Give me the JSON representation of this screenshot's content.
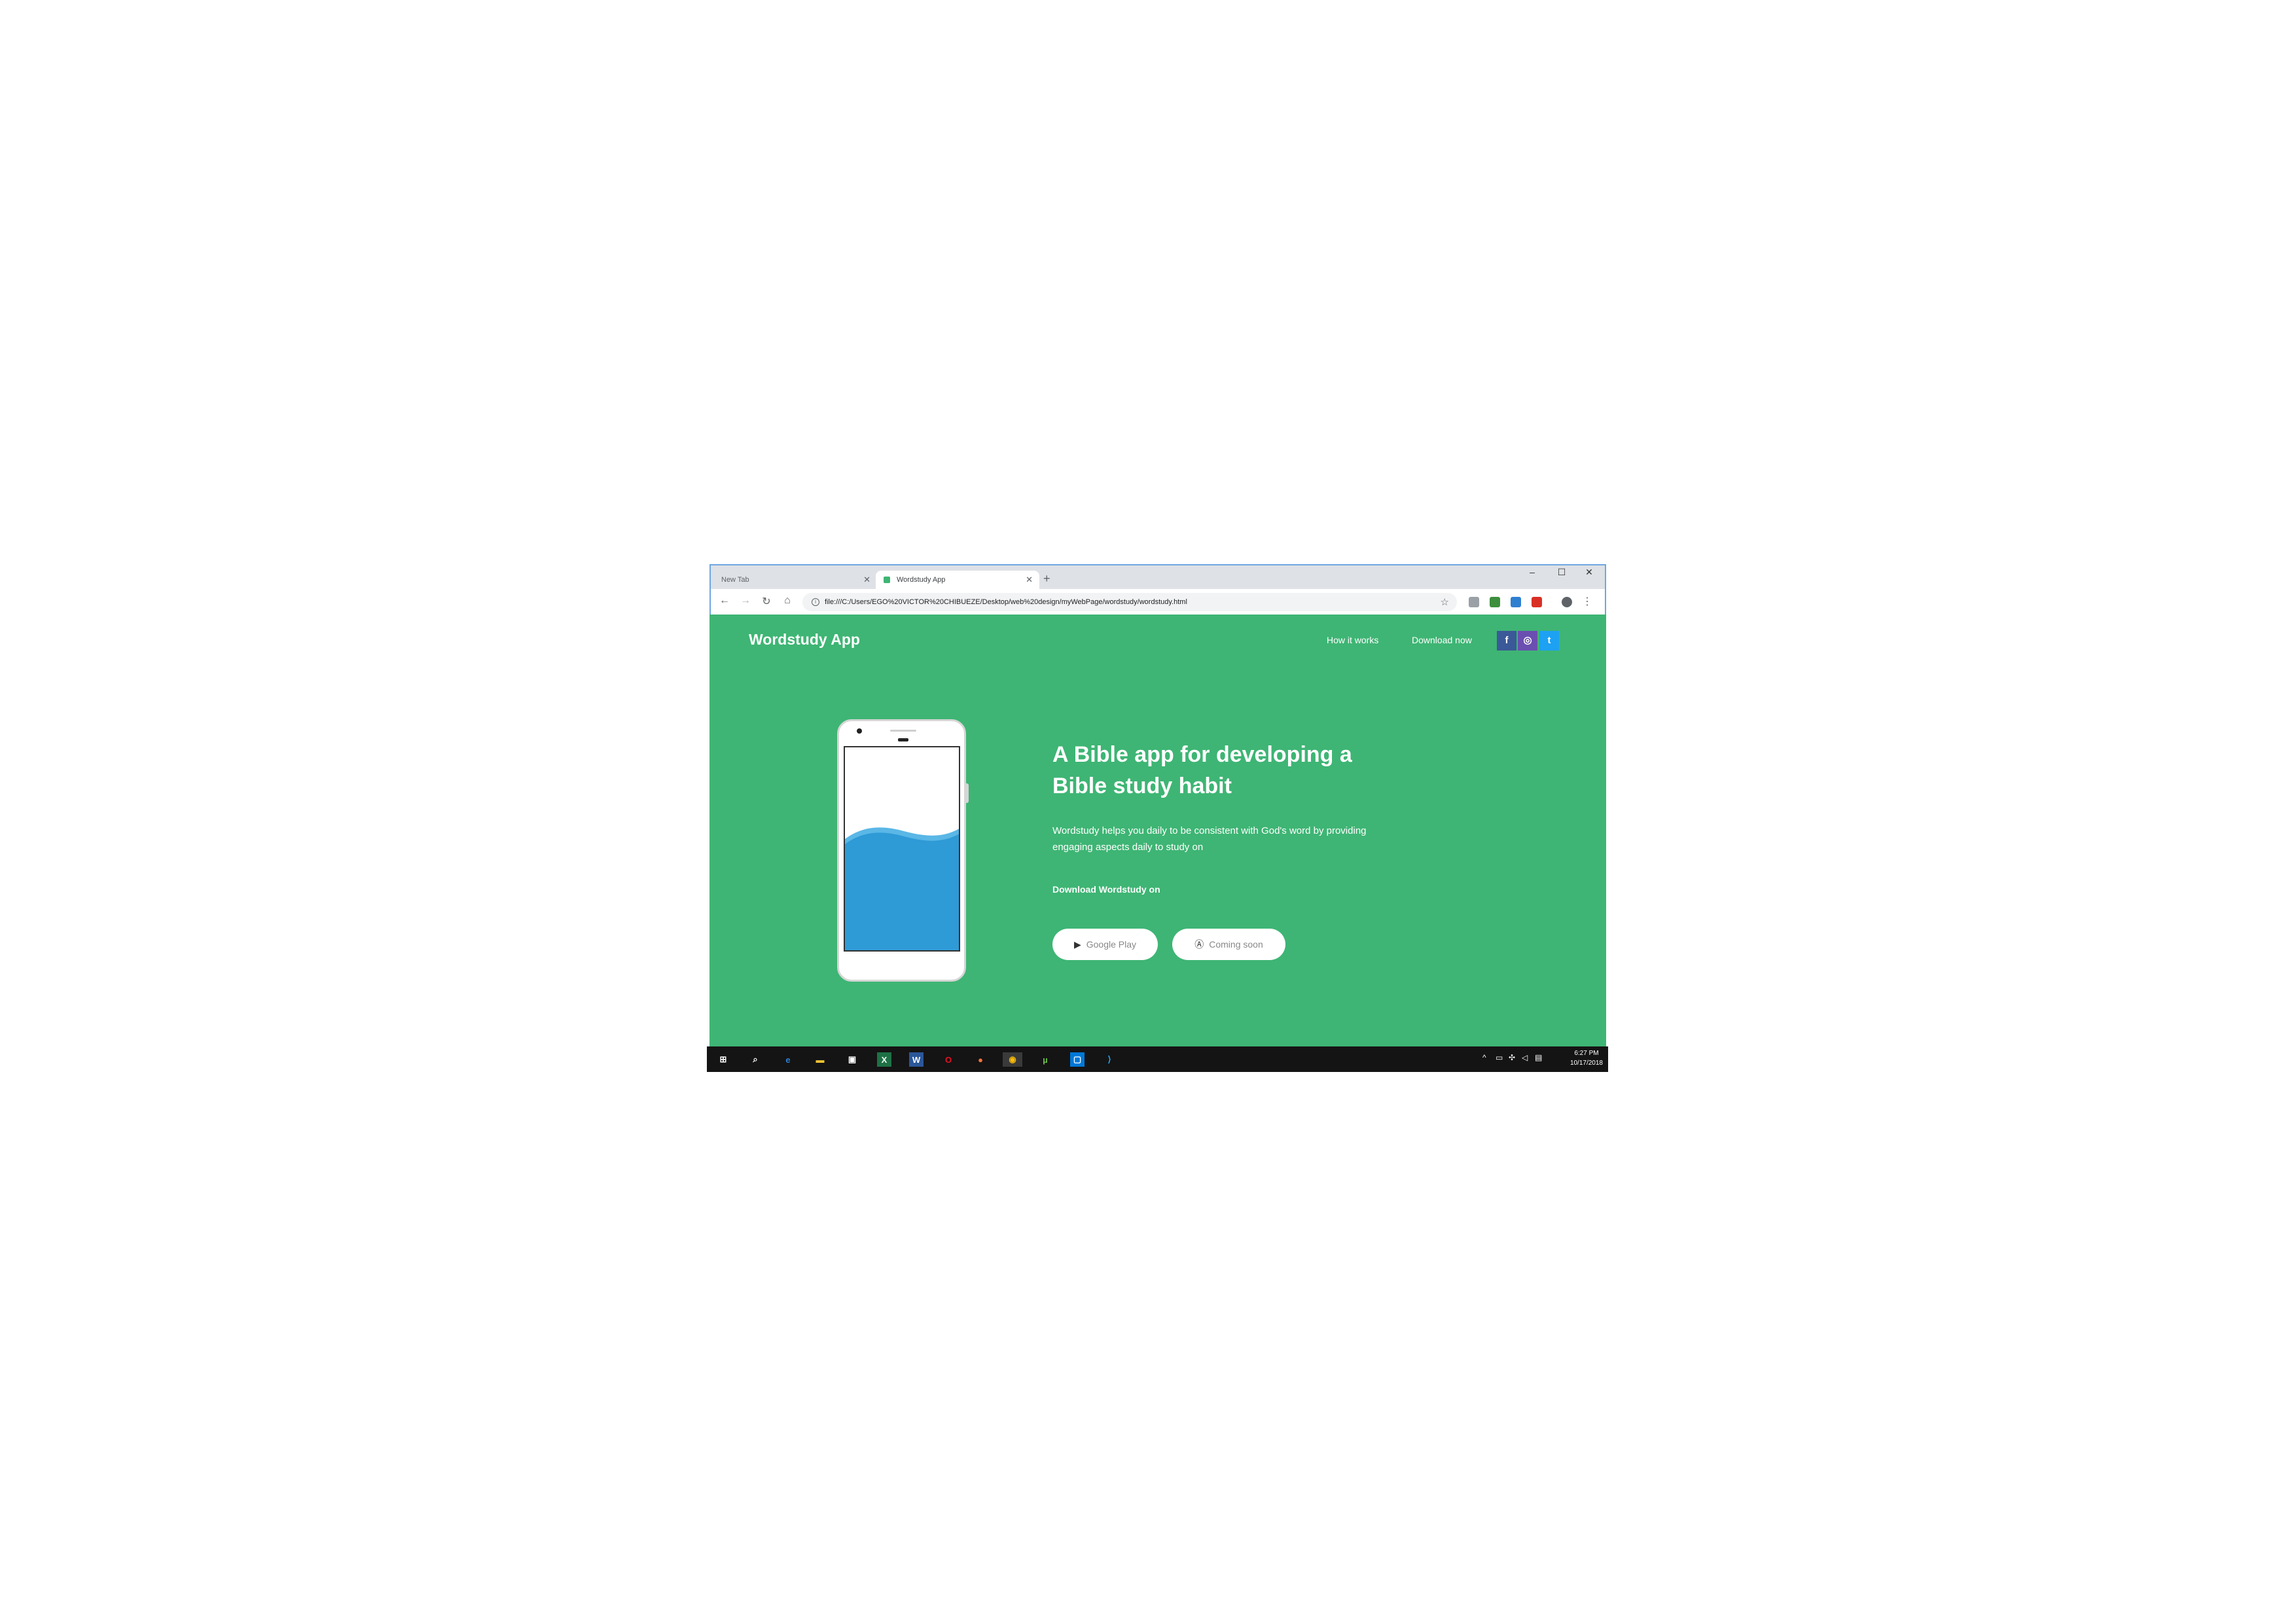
{
  "browser": {
    "tabs": [
      {
        "label": "New Tab",
        "active": false
      },
      {
        "label": "Wordstudy App",
        "active": true
      }
    ],
    "new_tab_glyph": "+",
    "url": "file:///C:/Users/EGO%20VICTOR%20CHIBUEZE/Desktop/web%20design/myWebPage/wordstudy/wordstudy.html",
    "window_controls": [
      "–",
      "☐",
      "✕"
    ]
  },
  "site": {
    "brand": "Wordstudy App",
    "nav": [
      "How it works",
      "Download now"
    ],
    "social": [
      {
        "name": "facebook",
        "glyph": "f",
        "color": "#3b5998"
      },
      {
        "name": "instagram",
        "glyph": "◎",
        "color": "#6a4fb0"
      },
      {
        "name": "twitter",
        "glyph": "t",
        "color": "#1da1f2"
      }
    ],
    "hero": {
      "headline_line1": "A Bible app for developing a",
      "headline_line2": "Bible study habit",
      "subtext_line1": "Wordstudy helps you daily to be consistent with God's word by providing",
      "subtext_line2": "engaging aspects daily to study on",
      "download_label": "Download Wordstudy on",
      "buttons": [
        {
          "icon": "google-play-icon",
          "label": "Google Play"
        },
        {
          "icon": "app-store-icon",
          "label": "Coming soon"
        }
      ]
    },
    "colors": {
      "background": "#3eb574",
      "wave": "#2e9ad6"
    }
  },
  "taskbar": {
    "apps": [
      "start-icon",
      "search-icon",
      "edge-icon",
      "file-explorer-icon",
      "store-icon",
      "excel-icon",
      "word-icon",
      "opera-icon",
      "firefox-icon",
      "chrome-icon",
      "utorrent-icon",
      "app-icon",
      "vscode-icon"
    ],
    "time": "6:27 PM",
    "date": "10/17/2018"
  }
}
